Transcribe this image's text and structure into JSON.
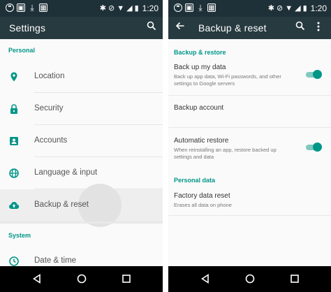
{
  "status": {
    "time": "1:20"
  },
  "left": {
    "title": "Settings",
    "sections": {
      "personal": "Personal",
      "system": "System"
    },
    "items": [
      {
        "label": "Location",
        "icon": "location-pin-icon"
      },
      {
        "label": "Security",
        "icon": "lock-icon"
      },
      {
        "label": "Accounts",
        "icon": "account-box-icon"
      },
      {
        "label": "Language & input",
        "icon": "globe-icon"
      },
      {
        "label": "Backup & reset",
        "icon": "cloud-upload-icon",
        "active": true
      },
      {
        "label": "Date & time",
        "icon": "clock-icon"
      }
    ]
  },
  "right": {
    "title": "Backup & reset",
    "sections": {
      "backup_restore": "Backup & restore",
      "personal_data": "Personal data"
    },
    "backup_my_data": {
      "title": "Back up my data",
      "subtitle": "Back up app data, Wi-Fi passwords, and other settings to Google servers",
      "enabled": true
    },
    "backup_account": {
      "title": "Backup account"
    },
    "automatic_restore": {
      "title": "Automatic restore",
      "subtitle": "When reinstalling an app, restore backed up settings and data",
      "enabled": true
    },
    "factory_reset": {
      "title": "Factory data reset",
      "subtitle": "Erases all data on phone"
    }
  },
  "colors": {
    "accent": "#009688",
    "toolbar": "#273a40",
    "statusbar": "#1f3138"
  }
}
